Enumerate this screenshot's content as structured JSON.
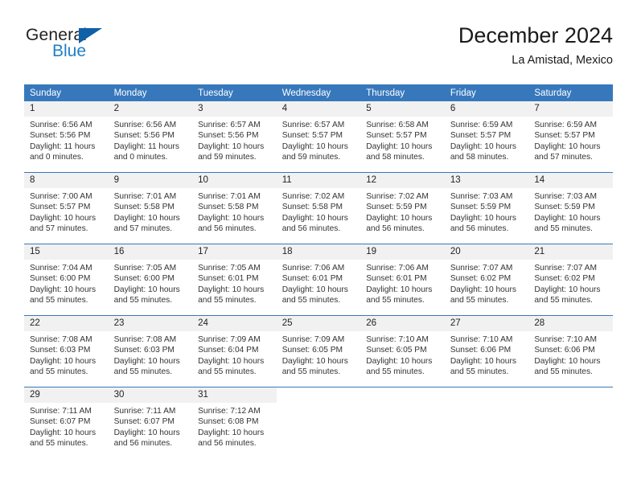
{
  "logo": {
    "word_one": "General",
    "word_two": "Blue",
    "triangle_icon": "blue-triangle-icon"
  },
  "header": {
    "title": "December 2024",
    "subtitle": "La Amistad, Mexico"
  },
  "colors": {
    "header_blue": "#3778bc",
    "daynum_gray": "#f1f1f1",
    "logo_blue": "#1f7fc4",
    "triangle_blue": "#1060a8",
    "text": "#222222"
  },
  "calendar": {
    "weekday_headers": [
      "Sunday",
      "Monday",
      "Tuesday",
      "Wednesday",
      "Thursday",
      "Friday",
      "Saturday"
    ],
    "weeks": [
      [
        {
          "day": "1",
          "sunrise": "Sunrise: 6:56 AM",
          "sunset": "Sunset: 5:56 PM",
          "daylight_1": "Daylight: 11 hours",
          "daylight_2": "and 0 minutes."
        },
        {
          "day": "2",
          "sunrise": "Sunrise: 6:56 AM",
          "sunset": "Sunset: 5:56 PM",
          "daylight_1": "Daylight: 11 hours",
          "daylight_2": "and 0 minutes."
        },
        {
          "day": "3",
          "sunrise": "Sunrise: 6:57 AM",
          "sunset": "Sunset: 5:56 PM",
          "daylight_1": "Daylight: 10 hours",
          "daylight_2": "and 59 minutes."
        },
        {
          "day": "4",
          "sunrise": "Sunrise: 6:57 AM",
          "sunset": "Sunset: 5:57 PM",
          "daylight_1": "Daylight: 10 hours",
          "daylight_2": "and 59 minutes."
        },
        {
          "day": "5",
          "sunrise": "Sunrise: 6:58 AM",
          "sunset": "Sunset: 5:57 PM",
          "daylight_1": "Daylight: 10 hours",
          "daylight_2": "and 58 minutes."
        },
        {
          "day": "6",
          "sunrise": "Sunrise: 6:59 AM",
          "sunset": "Sunset: 5:57 PM",
          "daylight_1": "Daylight: 10 hours",
          "daylight_2": "and 58 minutes."
        },
        {
          "day": "7",
          "sunrise": "Sunrise: 6:59 AM",
          "sunset": "Sunset: 5:57 PM",
          "daylight_1": "Daylight: 10 hours",
          "daylight_2": "and 57 minutes."
        }
      ],
      [
        {
          "day": "8",
          "sunrise": "Sunrise: 7:00 AM",
          "sunset": "Sunset: 5:57 PM",
          "daylight_1": "Daylight: 10 hours",
          "daylight_2": "and 57 minutes."
        },
        {
          "day": "9",
          "sunrise": "Sunrise: 7:01 AM",
          "sunset": "Sunset: 5:58 PM",
          "daylight_1": "Daylight: 10 hours",
          "daylight_2": "and 57 minutes."
        },
        {
          "day": "10",
          "sunrise": "Sunrise: 7:01 AM",
          "sunset": "Sunset: 5:58 PM",
          "daylight_1": "Daylight: 10 hours",
          "daylight_2": "and 56 minutes."
        },
        {
          "day": "11",
          "sunrise": "Sunrise: 7:02 AM",
          "sunset": "Sunset: 5:58 PM",
          "daylight_1": "Daylight: 10 hours",
          "daylight_2": "and 56 minutes."
        },
        {
          "day": "12",
          "sunrise": "Sunrise: 7:02 AM",
          "sunset": "Sunset: 5:59 PM",
          "daylight_1": "Daylight: 10 hours",
          "daylight_2": "and 56 minutes."
        },
        {
          "day": "13",
          "sunrise": "Sunrise: 7:03 AM",
          "sunset": "Sunset: 5:59 PM",
          "daylight_1": "Daylight: 10 hours",
          "daylight_2": "and 56 minutes."
        },
        {
          "day": "14",
          "sunrise": "Sunrise: 7:03 AM",
          "sunset": "Sunset: 5:59 PM",
          "daylight_1": "Daylight: 10 hours",
          "daylight_2": "and 55 minutes."
        }
      ],
      [
        {
          "day": "15",
          "sunrise": "Sunrise: 7:04 AM",
          "sunset": "Sunset: 6:00 PM",
          "daylight_1": "Daylight: 10 hours",
          "daylight_2": "and 55 minutes."
        },
        {
          "day": "16",
          "sunrise": "Sunrise: 7:05 AM",
          "sunset": "Sunset: 6:00 PM",
          "daylight_1": "Daylight: 10 hours",
          "daylight_2": "and 55 minutes."
        },
        {
          "day": "17",
          "sunrise": "Sunrise: 7:05 AM",
          "sunset": "Sunset: 6:01 PM",
          "daylight_1": "Daylight: 10 hours",
          "daylight_2": "and 55 minutes."
        },
        {
          "day": "18",
          "sunrise": "Sunrise: 7:06 AM",
          "sunset": "Sunset: 6:01 PM",
          "daylight_1": "Daylight: 10 hours",
          "daylight_2": "and 55 minutes."
        },
        {
          "day": "19",
          "sunrise": "Sunrise: 7:06 AM",
          "sunset": "Sunset: 6:01 PM",
          "daylight_1": "Daylight: 10 hours",
          "daylight_2": "and 55 minutes."
        },
        {
          "day": "20",
          "sunrise": "Sunrise: 7:07 AM",
          "sunset": "Sunset: 6:02 PM",
          "daylight_1": "Daylight: 10 hours",
          "daylight_2": "and 55 minutes."
        },
        {
          "day": "21",
          "sunrise": "Sunrise: 7:07 AM",
          "sunset": "Sunset: 6:02 PM",
          "daylight_1": "Daylight: 10 hours",
          "daylight_2": "and 55 minutes."
        }
      ],
      [
        {
          "day": "22",
          "sunrise": "Sunrise: 7:08 AM",
          "sunset": "Sunset: 6:03 PM",
          "daylight_1": "Daylight: 10 hours",
          "daylight_2": "and 55 minutes."
        },
        {
          "day": "23",
          "sunrise": "Sunrise: 7:08 AM",
          "sunset": "Sunset: 6:03 PM",
          "daylight_1": "Daylight: 10 hours",
          "daylight_2": "and 55 minutes."
        },
        {
          "day": "24",
          "sunrise": "Sunrise: 7:09 AM",
          "sunset": "Sunset: 6:04 PM",
          "daylight_1": "Daylight: 10 hours",
          "daylight_2": "and 55 minutes."
        },
        {
          "day": "25",
          "sunrise": "Sunrise: 7:09 AM",
          "sunset": "Sunset: 6:05 PM",
          "daylight_1": "Daylight: 10 hours",
          "daylight_2": "and 55 minutes."
        },
        {
          "day": "26",
          "sunrise": "Sunrise: 7:10 AM",
          "sunset": "Sunset: 6:05 PM",
          "daylight_1": "Daylight: 10 hours",
          "daylight_2": "and 55 minutes."
        },
        {
          "day": "27",
          "sunrise": "Sunrise: 7:10 AM",
          "sunset": "Sunset: 6:06 PM",
          "daylight_1": "Daylight: 10 hours",
          "daylight_2": "and 55 minutes."
        },
        {
          "day": "28",
          "sunrise": "Sunrise: 7:10 AM",
          "sunset": "Sunset: 6:06 PM",
          "daylight_1": "Daylight: 10 hours",
          "daylight_2": "and 55 minutes."
        }
      ],
      [
        {
          "day": "29",
          "sunrise": "Sunrise: 7:11 AM",
          "sunset": "Sunset: 6:07 PM",
          "daylight_1": "Daylight: 10 hours",
          "daylight_2": "and 55 minutes."
        },
        {
          "day": "30",
          "sunrise": "Sunrise: 7:11 AM",
          "sunset": "Sunset: 6:07 PM",
          "daylight_1": "Daylight: 10 hours",
          "daylight_2": "and 56 minutes."
        },
        {
          "day": "31",
          "sunrise": "Sunrise: 7:12 AM",
          "sunset": "Sunset: 6:08 PM",
          "daylight_1": "Daylight: 10 hours",
          "daylight_2": "and 56 minutes."
        },
        null,
        null,
        null,
        null
      ]
    ]
  }
}
